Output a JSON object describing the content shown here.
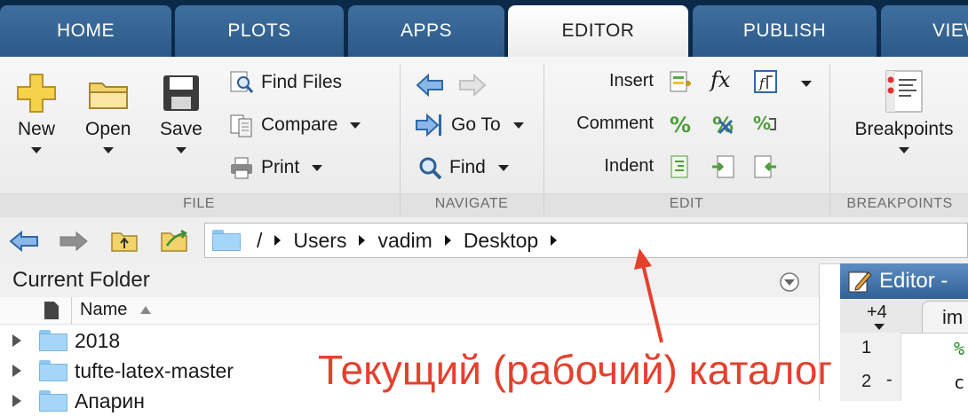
{
  "tabs": [
    {
      "label": "HOME",
      "active": false
    },
    {
      "label": "PLOTS",
      "active": false
    },
    {
      "label": "APPS",
      "active": false
    },
    {
      "label": "EDITOR",
      "active": true
    },
    {
      "label": "PUBLISH",
      "active": false
    },
    {
      "label": "VIEW",
      "active": false
    }
  ],
  "ribbon": {
    "file": {
      "title": "FILE",
      "new_label": "New",
      "open_label": "Open",
      "save_label": "Save",
      "find_files_label": "Find Files",
      "compare_label": "Compare",
      "print_label": "Print"
    },
    "navigate": {
      "title": "NAVIGATE",
      "goto_label": "Go To",
      "find_label": "Find"
    },
    "edit": {
      "title": "EDIT",
      "insert_label": "Insert",
      "comment_label": "Comment",
      "indent_label": "Indent",
      "fx_glyph": "fx"
    },
    "breakpoints": {
      "title": "BREAKPOINTS",
      "breakpoints_label": "Breakpoints"
    }
  },
  "address": {
    "root": "/",
    "crumbs": [
      "Users",
      "vadim",
      "Desktop"
    ]
  },
  "current_folder": {
    "title": "Current Folder",
    "column_name": "Name",
    "items": [
      {
        "name": "2018"
      },
      {
        "name": "tufte-latex-master"
      },
      {
        "name": "Апарин"
      }
    ]
  },
  "editor": {
    "title": "Editor -",
    "tab_more": "+4",
    "tab_label": "im",
    "lines": [
      {
        "num": "1",
        "mark": "",
        "code": "%"
      },
      {
        "num": "2",
        "mark": "-",
        "code": "c"
      }
    ]
  },
  "annotation": {
    "text": "Текущий (рабочий) каталог",
    "color": "#e4412e"
  },
  "colors": {
    "tab_bar": "#0b2a4a",
    "tab": "#2c5a88",
    "folder": "#a6d6f7",
    "editor_title": "#2f6196"
  }
}
